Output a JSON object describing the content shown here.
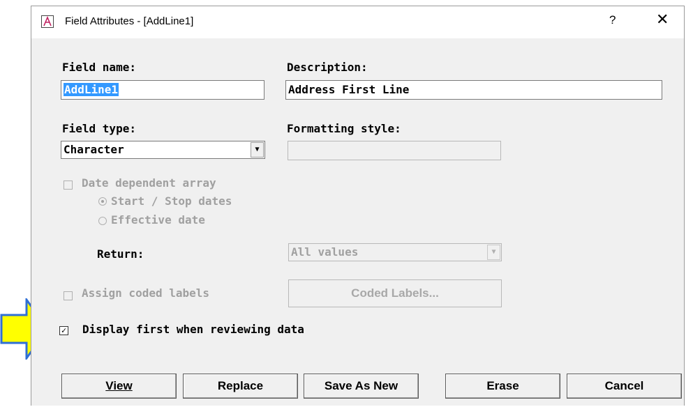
{
  "window": {
    "title": "Field Attributes - [AddLine1]",
    "help_glyph": "?",
    "close_glyph": "✕"
  },
  "form": {
    "field_name_label": "Field name:",
    "field_name_value": "AddLine1",
    "description_label": "Description:",
    "description_value": "Address First Line",
    "field_type_label": "Field type:",
    "field_type_value": "Character",
    "formatting_style_label": "Formatting style:",
    "formatting_style_value": "",
    "date_dependent_label": "Date dependent array",
    "start_stop_label": "Start / Stop dates",
    "effective_date_label": "Effective date",
    "return_label": "Return:",
    "return_value": "All values",
    "assign_coded_label": "Assign coded labels",
    "coded_labels_button": "Coded Labels...",
    "display_first_label": "Display first when reviewing data",
    "display_first_checked": true
  },
  "buttons": {
    "view": "View",
    "replace": "Replace",
    "save_as_new": "Save As New",
    "erase": "Erase",
    "cancel": "Cancel"
  },
  "colors": {
    "accent_arrow": "#ffff00",
    "arrow_outline": "#2f6fd6",
    "selection": "#3399ff"
  },
  "icons": {
    "app": "app-a-icon",
    "dropdown": "chevron-down-icon",
    "pointer": "right-arrow-icon"
  }
}
